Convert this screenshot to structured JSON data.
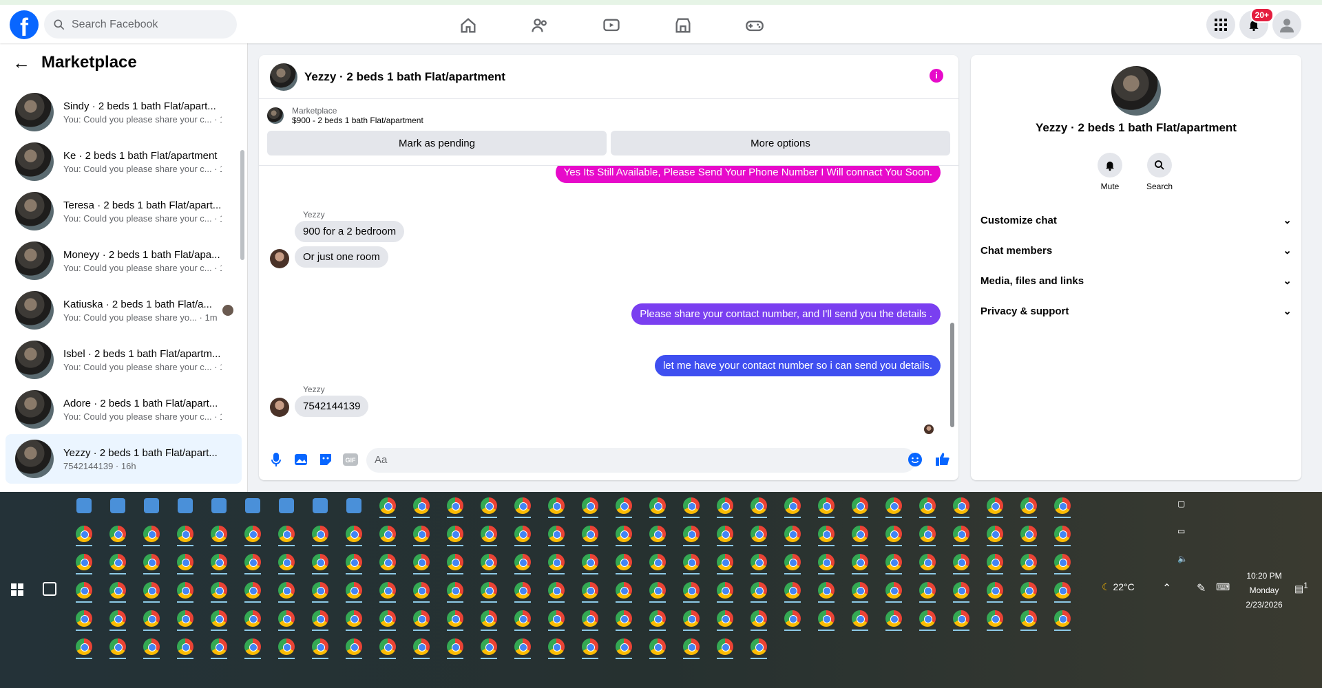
{
  "topbar": {
    "logo": "f",
    "search_placeholder": "Search Facebook",
    "nav": [
      "home-icon",
      "friends-icon",
      "watch-icon",
      "marketplace-icon",
      "gaming-icon"
    ],
    "notifications_badge": "20+"
  },
  "sidebar": {
    "title": "Marketplace",
    "threads": [
      {
        "name": "Sindy · 2 beds 1 bath Flat/apart...",
        "preview": "You: Could you please share your c... · 1m"
      },
      {
        "name": "Ke · 2 beds 1 bath Flat/apartment",
        "preview": "You: Could you please share your c... · 1m"
      },
      {
        "name": "Teresa · 2 beds 1 bath Flat/apart...",
        "preview": "You: Could you please share your c... · 1m"
      },
      {
        "name": "Moneyy · 2 beds 1 bath Flat/apa...",
        "preview": "You: Could you please share your c... · 1m"
      },
      {
        "name": "Katiuska · 2 beds 1 bath Flat/a...",
        "preview": "You: Could you please share yo... · 1m"
      },
      {
        "name": "Isbel · 2 beds 1 bath Flat/apartm...",
        "preview": "You: Could you please share your c... · 1m"
      },
      {
        "name": "Adore · 2 beds 1 bath Flat/apart...",
        "preview": "You: Could you please share your c... · 1m"
      },
      {
        "name": "Yezzy · 2 beds 1 bath Flat/apart...",
        "preview": "7542144139 · 16h"
      }
    ]
  },
  "chat": {
    "title": "Yezzy · 2 beds 1 bath Flat/apartment",
    "marketplace_label": "Marketplace",
    "listing": "$900 - 2 beds 1 bath Flat/apartment",
    "mark_pending": "Mark as pending",
    "more_options": "More options",
    "messages": {
      "m1": "Yes Its Still Available, Please Send Your Phone Number I Will connact You Soon.",
      "sender1": "Yezzy",
      "m2": "900 for a 2 bedroom",
      "m3": "Or just one room",
      "m4": "Please share your contact number, and I'll send you the details .",
      "m5": "let me have your contact number so i can send you details.",
      "sender2": "Yezzy",
      "m6": "7542144139"
    },
    "composer_placeholder": "Aa",
    "colors": {
      "pink": "#e70aca",
      "purple": "#7a3ff0",
      "blue": "#3f4ff0"
    }
  },
  "details": {
    "title": "Yezzy · 2 beds 1 bath Flat/apartment",
    "mute": "Mute",
    "search": "Search",
    "sections": [
      "Customize chat",
      "Chat members",
      "Media, files and links",
      "Privacy & support"
    ]
  },
  "taskbar": {
    "weather": "22°C",
    "time": "10:20 PM",
    "day": "Monday",
    "date": "2/23/2026",
    "notif_count": "1",
    "pinned": [
      "copilot-icon",
      "edge-icon",
      "file-explorer-icon",
      "amazon-icon",
      "store-icon",
      "outlook-icon",
      "chrome-profile-icon",
      "paint-icon",
      "sticky-notes-icon"
    ]
  }
}
